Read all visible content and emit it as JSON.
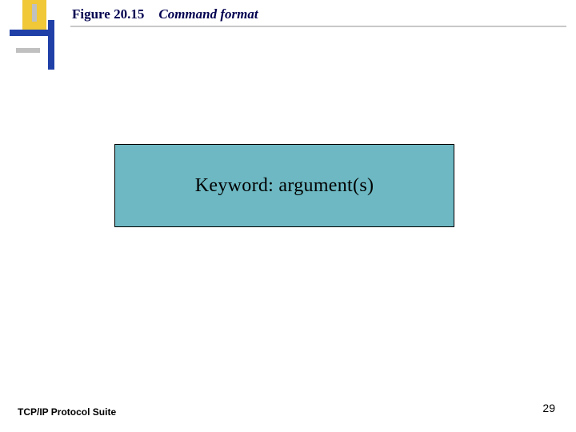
{
  "header": {
    "figure_number": "Figure 20.15",
    "figure_title": "Command format"
  },
  "content": {
    "box_text": "Keyword: argument(s)"
  },
  "footer": {
    "left_text": "TCP/IP Protocol Suite",
    "page_number": "29"
  },
  "colors": {
    "accent_yellow": "#f0c838",
    "accent_blue": "#2040a8",
    "box_fill": "#6db8c2"
  }
}
